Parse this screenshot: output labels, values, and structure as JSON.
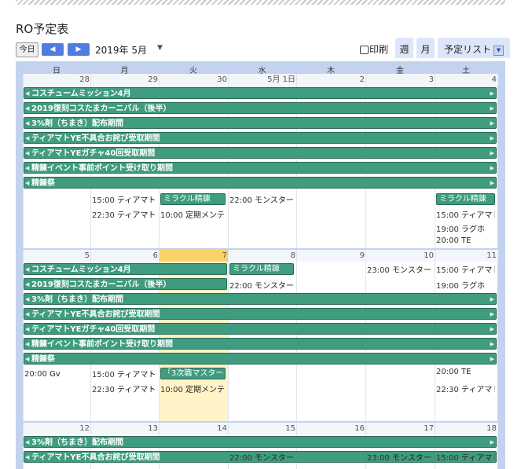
{
  "title": "RO予定表",
  "toolbar": {
    "today": "今日",
    "prev": "◀",
    "next": "▶",
    "month_label": "2019年 5月",
    "month_dd": "▼",
    "print": "印刷",
    "tab_week": "週",
    "tab_month": "月",
    "tab_agenda": "予定リスト",
    "agenda_dd": "▼"
  },
  "dow": [
    "日",
    "月",
    "火",
    "水",
    "木",
    "金",
    "土"
  ],
  "weeks": [
    {
      "days": [
        "28",
        "29",
        "30",
        "5月 1日",
        "2",
        "3",
        "4"
      ],
      "bars": [
        {
          "label": "コスチュームミッション4月",
          "left_arrow": "◀",
          "right_arrow": "▶"
        },
        {
          "label": "2019復刻コスたまカーニバル（後半）",
          "left_arrow": "◀",
          "right_arrow": "▶"
        },
        {
          "label": "3%剤（ちまき）配布期間",
          "left_arrow": "◀",
          "right_arrow": "▶"
        },
        {
          "label": "ティアマトYE不具合お詫び受取期間",
          "left_arrow": "◀",
          "right_arrow": "▶"
        },
        {
          "label": "ティアマトYEガチャ40回受取期間",
          "left_arrow": "◀",
          "right_arrow": "▶"
        },
        {
          "label": "精錬イベント事前ポイント受け取り期間",
          "left_arrow": "◀",
          "right_arrow": "▶"
        },
        {
          "label": "精錬祭",
          "left_arrow": "◀",
          "right_arrow": "▶"
        }
      ],
      "chips": [
        "ミラクル精錬",
        "ミラクル精錬"
      ],
      "events": [
        {
          "time": "15:00",
          "text": "ティアマト"
        },
        {
          "time": "22:30",
          "text": "ティアマト"
        },
        {
          "time": "10:00",
          "text": "定期メンテ"
        },
        {
          "time": "22:00",
          "text": "モンスター"
        },
        {
          "time": "15:00",
          "text": "ティアマト"
        },
        {
          "time": "19:00",
          "text": "ラグホ"
        },
        {
          "time": "20:00",
          "text": "TE"
        }
      ]
    },
    {
      "days": [
        "5",
        "6",
        "7",
        "8",
        "9",
        "10",
        "11"
      ],
      "bars": [
        {
          "label": "コスチュームミッション4月",
          "left_arrow": "◀"
        },
        {
          "label": "2019復刻コスたまカーニバル（後半）",
          "left_arrow": "◀"
        },
        {
          "label": "3%剤（ちまき）配布期間",
          "left_arrow": "◀",
          "right_arrow": "▶"
        },
        {
          "label": "ティアマトYE不具合お詫び受取期間",
          "left_arrow": "◀",
          "right_arrow": "▶"
        },
        {
          "label": "ティアマトYEガチャ40回受取期間",
          "left_arrow": "◀",
          "right_arrow": "▶"
        },
        {
          "label": "精錬イベント事前ポイント受け取り期間",
          "left_arrow": "◀",
          "right_arrow": "▶"
        },
        {
          "label": "精錬祭",
          "left_arrow": "◀",
          "right_arrow": "▶"
        }
      ],
      "chips": [
        "ミラクル精錬",
        "「3次職マスター"
      ],
      "events": [
        {
          "time": "22:00",
          "text": "モンスター"
        },
        {
          "time": "23:00",
          "text": "モンスター"
        },
        {
          "time": "15:00",
          "text": "ティアマト"
        },
        {
          "time": "19:00",
          "text": "ラグホ"
        },
        {
          "time": "20:00",
          "text": "Gv"
        },
        {
          "time": "15:00",
          "text": "ティアマト"
        },
        {
          "time": "22:30",
          "text": "ティアマト"
        },
        {
          "time": "10:00",
          "text": "定期メンテ"
        },
        {
          "time": "20:00",
          "text": "TE"
        },
        {
          "time": "22:30",
          "text": "ティアマト"
        }
      ]
    },
    {
      "days": [
        "12",
        "13",
        "14",
        "15",
        "16",
        "17",
        "18"
      ],
      "bars": [
        {
          "label": "3%剤（ちまき）配布期間",
          "left_arrow": "◀",
          "right_arrow": "▶"
        },
        {
          "label": "ティアマトYE不具合お詫び受取期間",
          "left_arrow": "◀"
        }
      ],
      "events": [
        {
          "time": "22:00",
          "text": "モンスター"
        },
        {
          "time": "23:00",
          "text": "モンスター"
        },
        {
          "time": "15:00",
          "text": "ティアマト"
        }
      ]
    }
  ],
  "colors": {
    "event_bar": "#3f9c7f",
    "calendar_bg": "#c3d2ef",
    "today_bg": "#fff3c7",
    "today_header": "#fbd169",
    "nav_button": "#4f7de0"
  }
}
